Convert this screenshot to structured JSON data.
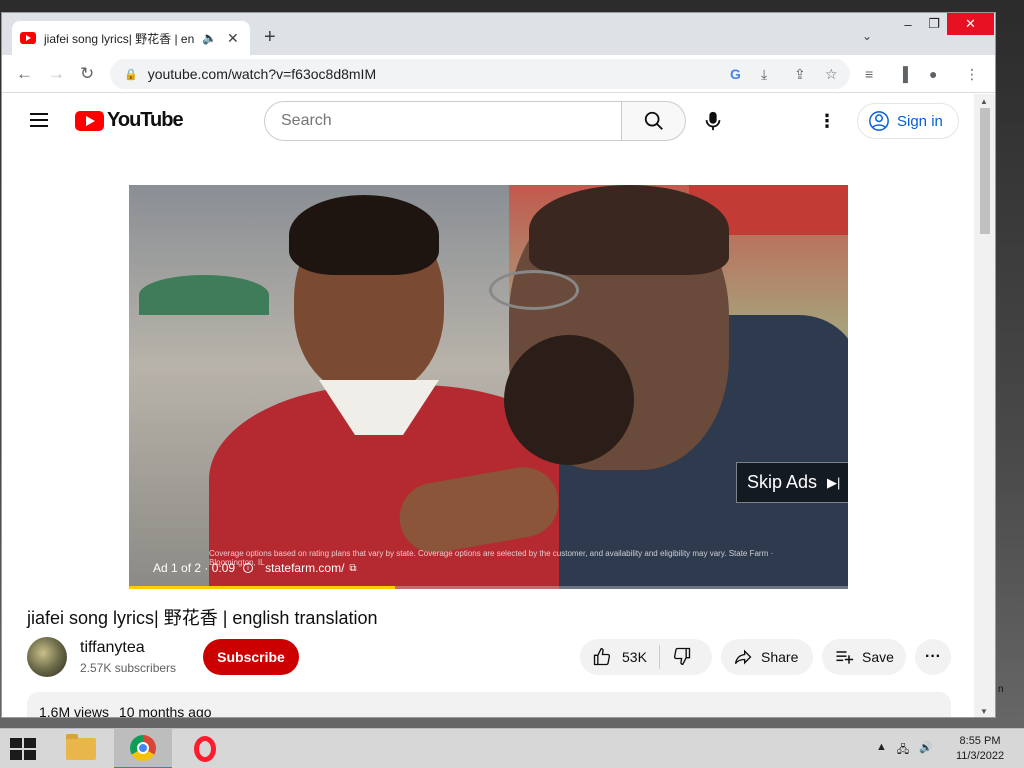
{
  "browser": {
    "tab_title": "jiafei song lyrics| 野花香 | en",
    "url": "youtube.com/watch?v=f63oc8d8mIM",
    "new_tab": "+",
    "window_controls": {
      "minimize": "–",
      "maximize": "❐",
      "close": "✕"
    }
  },
  "youtube": {
    "logo_text": "YouTube",
    "search_placeholder": "Search",
    "sign_in": "Sign in"
  },
  "player": {
    "ad_counter": "Ad 1 of 2 · 0:09",
    "ad_domain": "statefarm.com/",
    "fine_print": "Coverage options based on rating plans that vary by state. Coverage options are selected by the customer, and availability and eligibility may vary. State Farm · Bloomington, IL",
    "skip_label": "Skip Ads",
    "ad_progress_fraction": 0.37
  },
  "video": {
    "title": "jiafei song lyrics| 野花香 | english translation",
    "channel": "tiffanytea",
    "subscribers": "2.57K subscribers",
    "subscribe_label": "Subscribe",
    "likes": "53K",
    "share_label": "Share",
    "save_label": "Save",
    "views": "1.6M views",
    "date": "10 months ago"
  },
  "taskbar": {
    "time": "8:55 PM",
    "date": "11/3/2022"
  },
  "colors": {
    "youtube_red": "#ff0000",
    "subscribe_red": "#cc0000",
    "link_blue": "#065fd4",
    "ad_progress": "#ffcc00"
  }
}
